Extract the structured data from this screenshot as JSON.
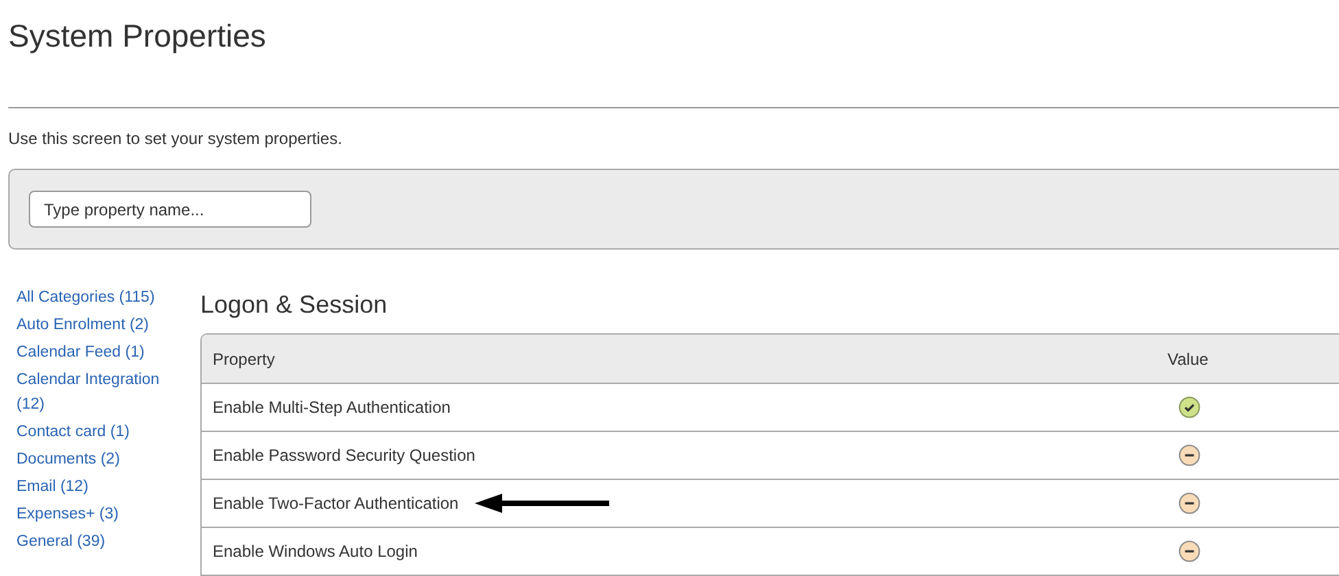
{
  "page": {
    "title": "System Properties",
    "description": "Use this screen to set your system properties."
  },
  "search": {
    "placeholder": "Type property name..."
  },
  "categories": [
    {
      "label": "All Categories (115)"
    },
    {
      "label": "Auto Enrolment (2)"
    },
    {
      "label": "Calendar Feed (1)"
    },
    {
      "label": "Calendar Integration (12)"
    },
    {
      "label": "Contact card (1)"
    },
    {
      "label": "Documents (2)"
    },
    {
      "label": "Email (12)"
    },
    {
      "label": "Expenses+ (3)"
    },
    {
      "label": "General (39)"
    }
  ],
  "section": {
    "title": "Logon & Session"
  },
  "table": {
    "columns": [
      "Property",
      "Value"
    ],
    "rows": [
      {
        "property": "Enable Multi-Step Authentication",
        "enabled": true,
        "annotated": false
      },
      {
        "property": "Enable Password Security Question",
        "enabled": false,
        "annotated": false
      },
      {
        "property": "Enable Two-Factor Authentication",
        "enabled": false,
        "annotated": true
      },
      {
        "property": "Enable Windows Auto Login",
        "enabled": false,
        "annotated": false
      }
    ]
  }
}
